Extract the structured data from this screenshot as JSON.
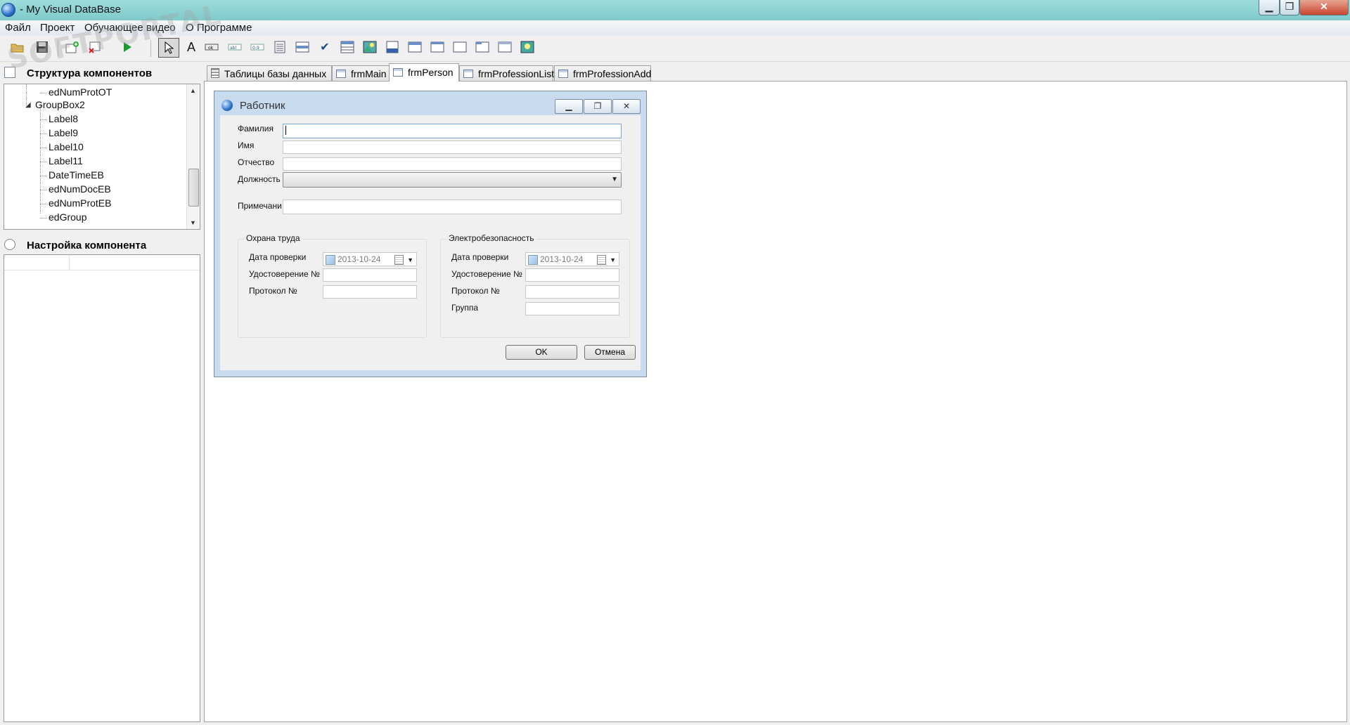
{
  "window": {
    "title": "- My Visual DataBase"
  },
  "menu": [
    "Файл",
    "Проект",
    "Обучающее видео",
    "О Программе"
  ],
  "toolbar": {
    "icons": [
      "open-folder-icon",
      "save-icon",
      "add-form-icon",
      "delete-form-icon",
      "run-icon",
      "pointer-icon",
      "label-tool-icon",
      "button-tool-icon",
      "edit-tool-icon",
      "number-tool-icon",
      "memo-tool-icon",
      "combobox-tool-icon",
      "checkbox-tool-icon",
      "table-grid-tool-icon",
      "image-tool-icon",
      "date-tool-icon",
      "time-tool-icon",
      "panel-tool-icon",
      "groupbox-tool-icon",
      "tabsheet-tool-icon",
      "form-tool-icon",
      "picture-tool-icon"
    ]
  },
  "left": {
    "structure_title": "Структура компонентов",
    "tree": [
      "edNumProtOT",
      "GroupBox2",
      "Label8",
      "Label9",
      "Label10",
      "Label11",
      "DateTimeEB",
      "edNumDocEB",
      "edNumProtEB",
      "edGroup"
    ],
    "settings_title": "Настройка компонента"
  },
  "tabs": [
    "Таблицы базы данных",
    "frmMain",
    "frmPerson",
    "frmProfessionList",
    "frmProfessionAdd"
  ],
  "form": {
    "title": "Работник",
    "btn_min": "—",
    "btn_max": "❐",
    "btn_close": "✕",
    "labels": {
      "lastname": "Фамилия",
      "firstname": "Имя",
      "patronymic": "Отчество",
      "position": "Должность",
      "note": "Примечани"
    },
    "group1": {
      "caption": "Охрана труда",
      "date_label": "Дата проверки",
      "date_value": "2013-10-24",
      "cert_label": "Удостоверение №",
      "protocol_label": "Протокол №"
    },
    "group2": {
      "caption": "Электробезопасность",
      "date_label": "Дата проверки",
      "date_value": "2013-10-24",
      "cert_label": "Удостоверение №",
      "protocol_label": "Протокол №",
      "group_label": "Группа"
    },
    "ok": "OK",
    "cancel": "Отмена"
  },
  "watermark": "SOFTPORTAL"
}
